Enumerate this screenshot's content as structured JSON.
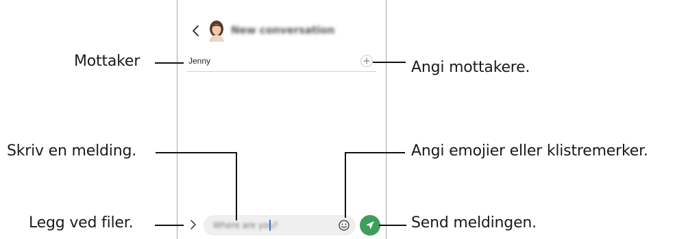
{
  "callouts": {
    "recipient": "Mottaker",
    "add_recipients": "Angi mottakere.",
    "write_message": "Skriv en melding.",
    "emoji_stickers": "Angi emojier eller klistremerker.",
    "attach_files": "Legg ved filer.",
    "send_message": "Send meldingen."
  },
  "screen": {
    "header": {
      "title": "New conversation",
      "back_icon": "chevron-left-icon",
      "avatar_icon": "contact-avatar-icon"
    },
    "recipient_field": {
      "value": "Jenny",
      "add_icon": "plus-circle-icon"
    },
    "composer": {
      "expand_icon": "chevron-right-icon",
      "placeholder": "Where are you?",
      "emoji_icon": "smiley-icon",
      "send_icon": "send-arrow-icon"
    }
  },
  "colors": {
    "send_button": "#3f9e5c",
    "input_background": "#efefef",
    "frame_border": "#a9a9a9"
  }
}
